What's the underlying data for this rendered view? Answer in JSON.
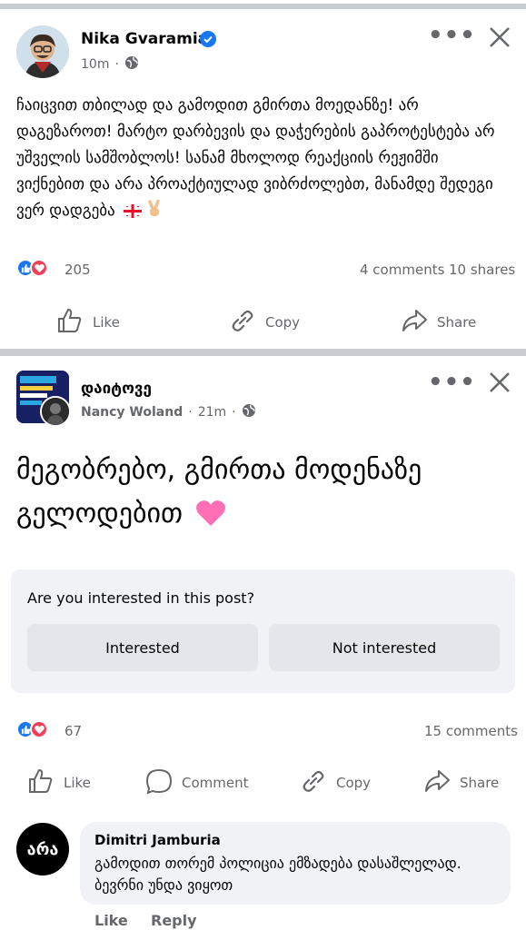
{
  "post1": {
    "author": "Nika Gvaramia",
    "time": "10m",
    "text": "ჩაიცვით თბილად და გამოდით გმირთა მოედანზე! არ დაგეზაროთ! მარტო დარბევის და დაჭერების გაპროტესტება არ უშველის სამშობლოს! სანამ მხოლოდ რეაქციის რეჟიმში ვიქნებით და არა პროაქტიულად ვიბრძოლებთ, მანამდე შედეგი ვერ დადგება",
    "reactions": "205",
    "comments": "4 comments",
    "shares": "10 shares",
    "actions": {
      "like": "Like",
      "copy": "Copy",
      "share": "Share"
    }
  },
  "post2": {
    "group": "დაიტოვე",
    "author": "Nancy Woland",
    "time": "21m",
    "text": "მეგობრებო, გმირთა მოდენაზე გელოდებით",
    "interest": {
      "question": "Are you interested in this post?",
      "yes": "Interested",
      "no": "Not interested"
    },
    "reactions": "67",
    "comments": "15 comments",
    "actions": {
      "like": "Like",
      "comment": "Comment",
      "copy": "Copy",
      "share": "Share"
    },
    "comment": {
      "author": "Dimitri Jamburia",
      "text": "გამოდით თორემ პოლიცია ემზადება დასაშლელად. ბევრნი უნდა ვიყოთ",
      "like": "Like",
      "reply": "Reply",
      "avatar_text": "არა"
    }
  },
  "colors": {
    "blue": "#1877f2",
    "red": "#f33e58",
    "gray": "#65676b"
  },
  "icons": [
    "verified-badge-icon",
    "globe-icon",
    "more-dots-icon",
    "close-icon",
    "like-icon",
    "copy-link-icon",
    "share-icon",
    "comment-icon",
    "heart-emoji-icon",
    "georgia-flag-icon",
    "victory-hand-icon"
  ]
}
